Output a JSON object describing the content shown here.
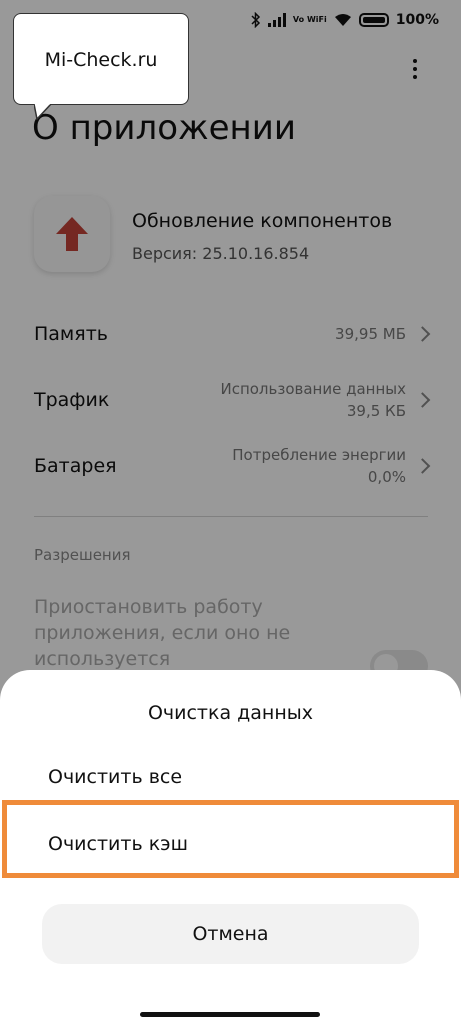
{
  "status_bar": {
    "vowifi": "Vo WiFi",
    "battery": "100%"
  },
  "header": {
    "title": "О приложении"
  },
  "app": {
    "name": "Обновление компонентов",
    "version": "Версия: 25.10.16.854",
    "icon": "red-up-arrow-icon"
  },
  "info_rows": [
    {
      "label": "Память",
      "value_line1": "39,95 МБ",
      "value_line2": ""
    },
    {
      "label": "Трафик",
      "value_line1": "Использование данных",
      "value_line2": "39,5 КБ"
    },
    {
      "label": "Батарея",
      "value_line1": "Потребление энергии",
      "value_line2": "0,0%"
    }
  ],
  "permissions": {
    "section_title": "Разрешения",
    "pause_app_text": "Приостановить работу приложения, если оно не используется",
    "pause_app_enabled": false
  },
  "sheet": {
    "title": "Очистка данных",
    "options": [
      {
        "label": "Очистить все"
      },
      {
        "label": "Очистить кэш"
      }
    ],
    "cancel_label": "Отмена"
  },
  "watermark": {
    "text": "Mi-Check.ru"
  },
  "colors": {
    "highlight": "#ef8b3a",
    "app_icon_arrow": "#c4443a"
  }
}
